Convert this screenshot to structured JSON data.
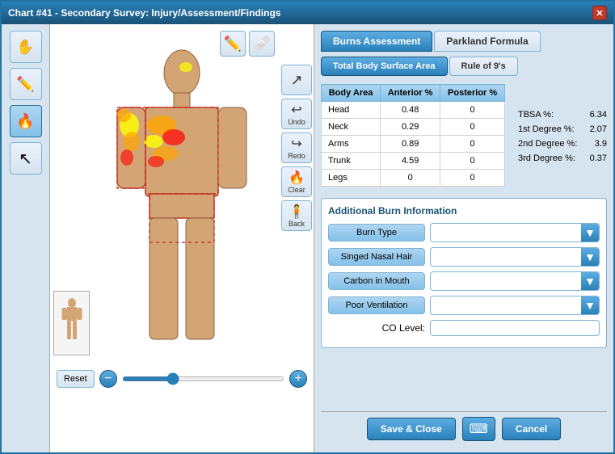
{
  "window": {
    "title": "Chart #41 - Secondary Survey: Injury/Assessment/Findings",
    "close_label": "✕"
  },
  "tabs": {
    "burns_assessment": "Burns Assessment",
    "parkland_formula": "Parkland Formula"
  },
  "sub_tabs": {
    "total_body_surface_area": "Total Body Surface Area",
    "rule_of_nines": "Rule of 9's"
  },
  "table": {
    "headers": [
      "Body Area",
      "Anterior %",
      "Posterior %"
    ],
    "rows": [
      {
        "area": "Head",
        "anterior": "0.48",
        "posterior": "0"
      },
      {
        "area": "Neck",
        "anterior": "0.29",
        "posterior": "0"
      },
      {
        "area": "Arms",
        "anterior": "0.89",
        "posterior": "0"
      },
      {
        "area": "Trunk",
        "anterior": "4.59",
        "posterior": "0"
      },
      {
        "area": "Legs",
        "anterior": "0",
        "posterior": "0"
      }
    ]
  },
  "stats": {
    "tbsa_label": "TBSA %:",
    "tbsa_value": "6.34",
    "first_degree_label": "1st Degree %:",
    "first_degree_value": "2.07",
    "second_degree_label": "2nd Degree %:",
    "second_degree_value": "3.9",
    "third_degree_label": "3rd Degree %:",
    "third_degree_value": "0.37"
  },
  "additional": {
    "title": "Additional Burn Information",
    "fields": [
      {
        "label": "Burn Type",
        "type": "dropdown",
        "value": ""
      },
      {
        "label": "Singed Nasal Hair",
        "type": "dropdown",
        "value": ""
      },
      {
        "label": "Carbon in Mouth",
        "type": "dropdown",
        "value": ""
      },
      {
        "label": "Poor Ventilation",
        "type": "dropdown",
        "value": ""
      },
      {
        "label": "CO Level:",
        "type": "input",
        "value": ""
      }
    ]
  },
  "controls": {
    "reset": "Reset",
    "undo": "Undo",
    "redo": "Redo",
    "clear": "Clear",
    "back": "Back",
    "save_close": "Save & Close",
    "cancel": "Cancel"
  },
  "tools": [
    {
      "name": "hand",
      "icon": "✋"
    },
    {
      "name": "pencil",
      "icon": "✏️"
    },
    {
      "name": "fire",
      "icon": "🔥"
    },
    {
      "name": "pointer",
      "icon": "↖"
    }
  ]
}
